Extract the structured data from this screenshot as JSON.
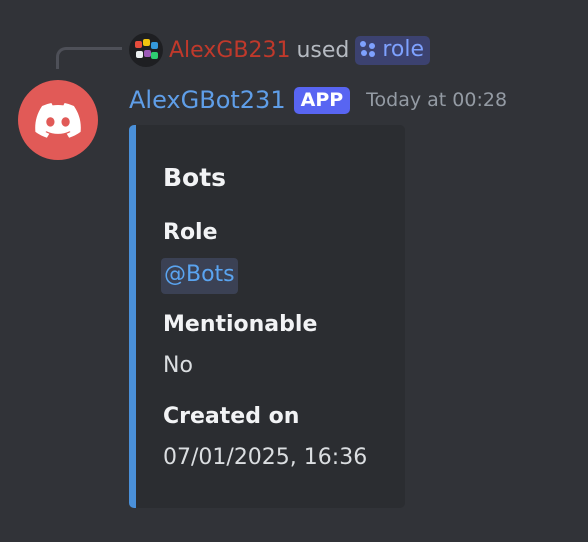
{
  "interaction": {
    "invoker_name": "AlexGB231",
    "used_text": "used",
    "command_name": "role"
  },
  "message": {
    "author": "AlexGBot231",
    "badge": "APP",
    "timestamp": "Today at 00:28",
    "avatar_icon": "discord-logo-icon"
  },
  "embed": {
    "accent_color": "#4a90d9",
    "title": "Bots",
    "fields": [
      {
        "name": "Role",
        "value": "@Bots"
      },
      {
        "name": "Mentionable",
        "value": "No"
      },
      {
        "name": "Created on",
        "value": "07/01/2025, 16:36"
      }
    ]
  },
  "colors": {
    "background": "#313338",
    "embed_background": "#2b2d31",
    "author_name": "#5f9ee8",
    "invoker_name": "#c0392b",
    "app_badge": "#5865f2",
    "avatar": "#e15a57",
    "mention": "#5aa4f0"
  }
}
